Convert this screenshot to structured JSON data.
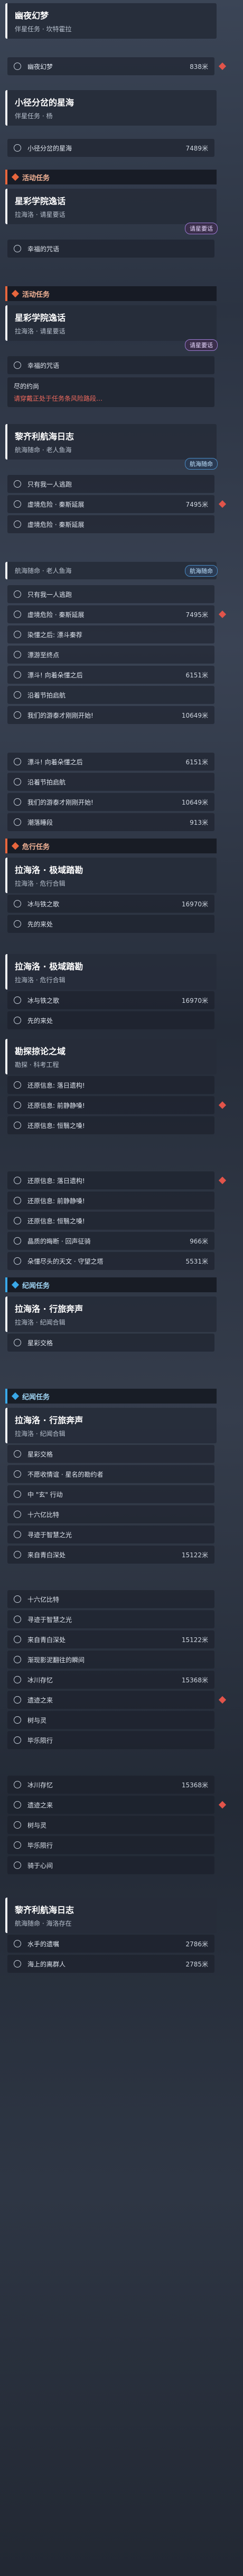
{
  "top_block": {
    "title": "幽夜幻梦",
    "subtitle": "伴星任务 · 坎特霍拉",
    "row": {
      "label": "幽夜幻梦",
      "dist": "838米"
    }
  },
  "block2": {
    "title": "小径分岔的星海",
    "subtitle": "伴星任务 · 杨",
    "row": {
      "label": "小径分岔的星海",
      "dist": "7489米"
    }
  },
  "section_activity": {
    "label": "活动任务"
  },
  "block3": {
    "title": "星彩学院逸话",
    "subtitle": "拉海洛 · 请星要话",
    "row": {
      "label": "幸福的咒语"
    },
    "tag": "请星要话"
  },
  "section_activity2": {
    "label": "活动任务"
  },
  "block4": {
    "title": "星彩学院逸话",
    "subtitle": "拉海洛 · 请星要话",
    "row1": {
      "label": "幸福的咒语"
    },
    "warn": {
      "title": "尽的约尚",
      "note": "请穿戴正处于任务条风险路段…"
    },
    "tag": "请星要话"
  },
  "block5": {
    "title": "黎齐利航海日志",
    "subtitle": "航海随命 · 老人鱼海",
    "tag": "航海随命",
    "rows": [
      {
        "label": "只有我一人逃跑",
        "dist": ""
      },
      {
        "label": "虚境危险 · 秦斯延展",
        "dist": "7495米"
      },
      {
        "label": "虚境危险 · 秦斯延展",
        "dist": ""
      }
    ]
  },
  "block6": {
    "header": "航海随命 · 老人鱼海",
    "tag": "航海随命",
    "rows": [
      {
        "label": "只有我一人逃跑",
        "dist": ""
      },
      {
        "label": "虚境危险 · 秦斯延展",
        "dist": "7495米"
      },
      {
        "label": "染懂之后: 漂斗秦荐",
        "dist": ""
      },
      {
        "label": "漂游至终点",
        "dist": ""
      },
      {
        "label": "漂斗! 向着朵懂之后",
        "dist": "6151米"
      },
      {
        "label": "沿着节拍启航",
        "dist": ""
      },
      {
        "label": "我们的游泰才刚刚开始!",
        "dist": "10649米"
      }
    ]
  },
  "block7": {
    "rows": [
      {
        "label": "漂斗! 向着朵懂之后",
        "dist": "6151米"
      },
      {
        "label": "沿着节拍启航",
        "dist": ""
      },
      {
        "label": "我们的游泰才刚刚开始!",
        "dist": "10649米"
      },
      {
        "label": "潮落睡段",
        "dist": "913米"
      }
    ]
  },
  "section_danger": {
    "label": "危行任务"
  },
  "block8": {
    "title": "拉海洛 · 极域踏勘",
    "subtitle": "拉海洛 · 危行合辑",
    "rows": [
      {
        "label": "冰与铁之歌",
        "dist": "16970米"
      },
      {
        "label": "先的来处",
        "dist": ""
      }
    ]
  },
  "block9": {
    "title": "拉海洛 · 极域踏勘",
    "subtitle": "拉海洛 · 危行合辑",
    "rows": [
      {
        "label": "冰与铁之歌",
        "dist": "16970米"
      },
      {
        "label": "先的来处",
        "dist": ""
      }
    ]
  },
  "block10": {
    "title": "勘探掠论之域",
    "subtitle": "勘探 · 科考工程",
    "rows": [
      {
        "label": "还原信息: 落日遗构!",
        "dist": ""
      },
      {
        "label": "还原信息: 前静静嗓!",
        "dist": ""
      },
      {
        "label": "还原信息: 恒翳之嗓!",
        "dist": ""
      }
    ]
  },
  "block11": {
    "rows": [
      {
        "label": "还原信息: 落日遗构!",
        "dist": ""
      },
      {
        "label": "还原信息: 前静静嗓!",
        "dist": ""
      },
      {
        "label": "还原信息: 恒翳之嗓!",
        "dist": ""
      },
      {
        "label": "晶质的晦断 · 回声征骑",
        "dist": "966米"
      },
      {
        "label": "朵懂尽头的天文 · 守望之塔",
        "dist": "5531米"
      }
    ]
  },
  "section_memo": {
    "label": "纪闻任务"
  },
  "block12": {
    "title": "拉海洛 · 行旅奔声",
    "subtitle": "拉海洛 · 纪闻合辑",
    "rows": [
      {
        "label": "星彩交格",
        "dist": ""
      }
    ]
  },
  "section_memo2": {
    "label": "纪闻任务"
  },
  "block13": {
    "title": "拉海洛 · 行旅奔声",
    "subtitle": "拉海洛 · 纪闻合辑",
    "rows": [
      {
        "label": "星彩交格",
        "dist": ""
      },
      {
        "label": "不愿收情谊 · 星名的勘约者",
        "dist": ""
      },
      {
        "label": "中 \"玄\" 行动",
        "dist": ""
      },
      {
        "label": "十六亿比特",
        "dist": ""
      },
      {
        "label": "寻迹于智慧之光",
        "dist": ""
      },
      {
        "label": "来自青白深处",
        "dist": "15122米"
      }
    ]
  },
  "block14": {
    "rows": [
      {
        "label": "十六亿比特",
        "dist": ""
      },
      {
        "label": "寻迹于智慧之光",
        "dist": ""
      },
      {
        "label": "来自青白深处",
        "dist": "15122米"
      },
      {
        "label": "渐现影泥翻往的瞬间",
        "dist": ""
      },
      {
        "label": "冰川存忆",
        "dist": "15368米"
      },
      {
        "label": "遗迹之来",
        "dist": ""
      },
      {
        "label": "树与灵",
        "dist": ""
      },
      {
        "label": "毕乐陨行",
        "dist": ""
      }
    ]
  },
  "block15": {
    "rows": [
      {
        "label": "冰川存忆",
        "dist": "15368米"
      },
      {
        "label": "遗迹之来",
        "dist": ""
      },
      {
        "label": "树与灵",
        "dist": ""
      },
      {
        "label": "毕乐陨行",
        "dist": ""
      },
      {
        "label": "骑于心间",
        "dist": ""
      }
    ]
  },
  "block16": {
    "title": "黎齐利航海日志",
    "subtitle": "航海随命 · 海洛存在",
    "rows": [
      {
        "label": "水手的遗嘱",
        "dist": "2786米"
      },
      {
        "label": "海上的离群人",
        "dist": "2785米"
      }
    ]
  }
}
